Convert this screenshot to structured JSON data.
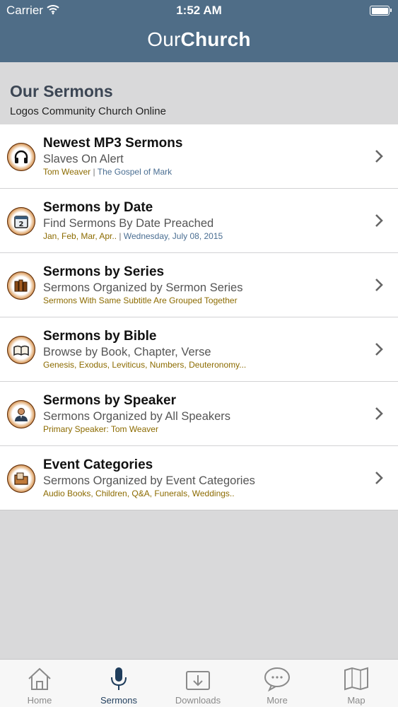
{
  "status_bar": {
    "carrier": "Carrier",
    "time": "1:52 AM"
  },
  "header": {
    "brand_light": "Our",
    "brand_bold": "Church"
  },
  "section": {
    "title": "Our Sermons",
    "subtitle": "Logos Community Church Online"
  },
  "rows": [
    {
      "icon": "headphones-icon",
      "title": "Newest MP3 Sermons",
      "subtitle": "Slaves On Alert",
      "meta_a": "Tom Weaver",
      "meta_sep": "|",
      "meta_b": "The Gospel of Mark"
    },
    {
      "icon": "calendar-icon",
      "title": "Sermons by Date",
      "subtitle": "Find Sermons By Date Preached",
      "meta_a": "Jan, Feb, Mar, Apr..",
      "meta_sep": "|",
      "meta_b": "Wednesday, July 08, 2015"
    },
    {
      "icon": "books-icon",
      "title": "Sermons by Series",
      "subtitle": "Sermons Organized by Sermon Series",
      "meta_a": "Sermons With Same Subtitle Are Grouped Together"
    },
    {
      "icon": "open-bible-icon",
      "title": "Sermons by Bible",
      "subtitle": "Browse by Book, Chapter, Verse",
      "meta_a": "Genesis, Exodus, Leviticus, Numbers, Deuteronomy..."
    },
    {
      "icon": "speaker-person-icon",
      "title": "Sermons by Speaker",
      "subtitle": "Sermons Organized by All Speakers",
      "meta_a": "Primary Speaker: Tom Weaver"
    },
    {
      "icon": "folder-icon",
      "title": "Event Categories",
      "subtitle": "Sermons Organized by Event Categories",
      "meta_a": "Audio Books, Children, Q&A, Funerals, Weddings.."
    }
  ],
  "tabs": [
    {
      "icon": "home-icon",
      "label": "Home",
      "active": false
    },
    {
      "icon": "microphone-icon",
      "label": "Sermons",
      "active": true
    },
    {
      "icon": "download-icon",
      "label": "Downloads",
      "active": false
    },
    {
      "icon": "speech-bubble-icon",
      "label": "More",
      "active": false
    },
    {
      "icon": "map-icon",
      "label": "Map",
      "active": false
    }
  ],
  "colors": {
    "header": "#4f6d87",
    "background": "#d9d9da",
    "meta_gold": "#8c6b00",
    "active_tab": "#1f3d5c"
  }
}
